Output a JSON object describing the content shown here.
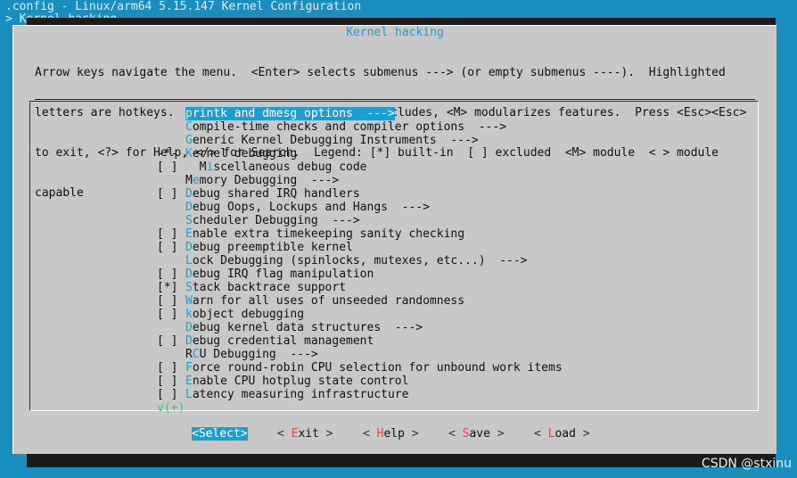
{
  "window": {
    "title_line": ".config - Linux/arm64 5.15.147 Kernel Configuration",
    "breadcrumb_line": "> Kernel hacking"
  },
  "dialog": {
    "title": "Kernel hacking",
    "help_lines": [
      "Arrow keys navigate the menu.  <Enter> selects submenus ---> (or empty submenus ----).  Highlighted",
      "letters are hotkeys.  Pressing <Y> includes, <N> excludes, <M> modularizes features.  Press <Esc><Esc>",
      "to exit, <?> for Help, </> for Search.  Legend: [*] built-in  [ ] excluded  <M> module  < > module",
      "capable"
    ]
  },
  "menu": {
    "items": [
      {
        "mark": "",
        "hotkey": "p",
        "rest": "rintk and dmesg options  --->",
        "selected": true
      },
      {
        "mark": "",
        "hotkey": "C",
        "rest": "ompile-time checks and compiler options  --->"
      },
      {
        "mark": "",
        "hotkey": "G",
        "rest": "eneric Kernel Debugging Instruments  --->"
      },
      {
        "mark": "-*-",
        "hotkey": "K",
        "rest": "ernel debugging"
      },
      {
        "mark": "[ ]",
        "pre": "  M",
        "hotkey": "i",
        "rest": "scellaneous debug code"
      },
      {
        "mark": "",
        "pre": "M",
        "hotkey": "e",
        "rest": "mory Debugging  --->"
      },
      {
        "mark": "[ ]",
        "hotkey": "D",
        "rest": "ebug shared IRQ handlers"
      },
      {
        "mark": "",
        "hotkey": "D",
        "rest": "ebug Oops, Lockups and Hangs  --->"
      },
      {
        "mark": "",
        "hotkey": "S",
        "rest": "cheduler Debugging  --->"
      },
      {
        "mark": "[ ]",
        "hotkey": "E",
        "rest": "nable extra timekeeping sanity checking"
      },
      {
        "mark": "[ ]",
        "hotkey": "D",
        "rest": "ebug preemptible kernel"
      },
      {
        "mark": "",
        "hotkey": "L",
        "rest": "ock Debugging (spinlocks, mutexes, etc...)  --->"
      },
      {
        "mark": "[ ]",
        "hotkey": "D",
        "rest": "ebug IRQ flag manipulation"
      },
      {
        "mark": "[*]",
        "hotkey": "S",
        "rest": "tack backtrace support"
      },
      {
        "mark": "[ ]",
        "hotkey": "W",
        "rest": "arn for all uses of unseeded randomness"
      },
      {
        "mark": "[ ]",
        "hotkey": "k",
        "rest": "object debugging"
      },
      {
        "mark": "",
        "hotkey": "D",
        "rest": "ebug kernel data structures  --->"
      },
      {
        "mark": "[ ]",
        "hotkey": "D",
        "rest": "ebug credential management"
      },
      {
        "mark": "",
        "pre": "R",
        "hotkey": "C",
        "rest": "U Debugging  --->"
      },
      {
        "mark": "[ ]",
        "hotkey": "F",
        "rest": "orce round-robin CPU selection for unbound work items"
      },
      {
        "mark": "[ ]",
        "hotkey": "E",
        "rest": "nable CPU hotplug state control"
      },
      {
        "mark": "[ ]",
        "hotkey": "L",
        "rest": "atency measuring infrastructure"
      }
    ],
    "scroll_indicator": "v(+)"
  },
  "buttons": [
    {
      "left": "<",
      "hotkey": "S",
      "rest": "elect",
      "right": ">",
      "active": true
    },
    {
      "left": "< ",
      "hotkey": "E",
      "rest": "xit",
      "right": " >"
    },
    {
      "left": "< ",
      "hotkey": "H",
      "rest": "elp",
      "right": " >"
    },
    {
      "left": "< ",
      "hotkey": "S",
      "rest": "ave",
      "right": " >"
    },
    {
      "left": "< ",
      "hotkey": "L",
      "rest": "oad",
      "right": " >"
    }
  ],
  "watermark": "CSDN @stxinu",
  "colors": {
    "accent": "#1e9ecf",
    "background": "#1a8fbf",
    "dialog": "#c8c8c8",
    "scroll_green": "#2fd05a",
    "button_hotkey": "#e04a4a"
  }
}
